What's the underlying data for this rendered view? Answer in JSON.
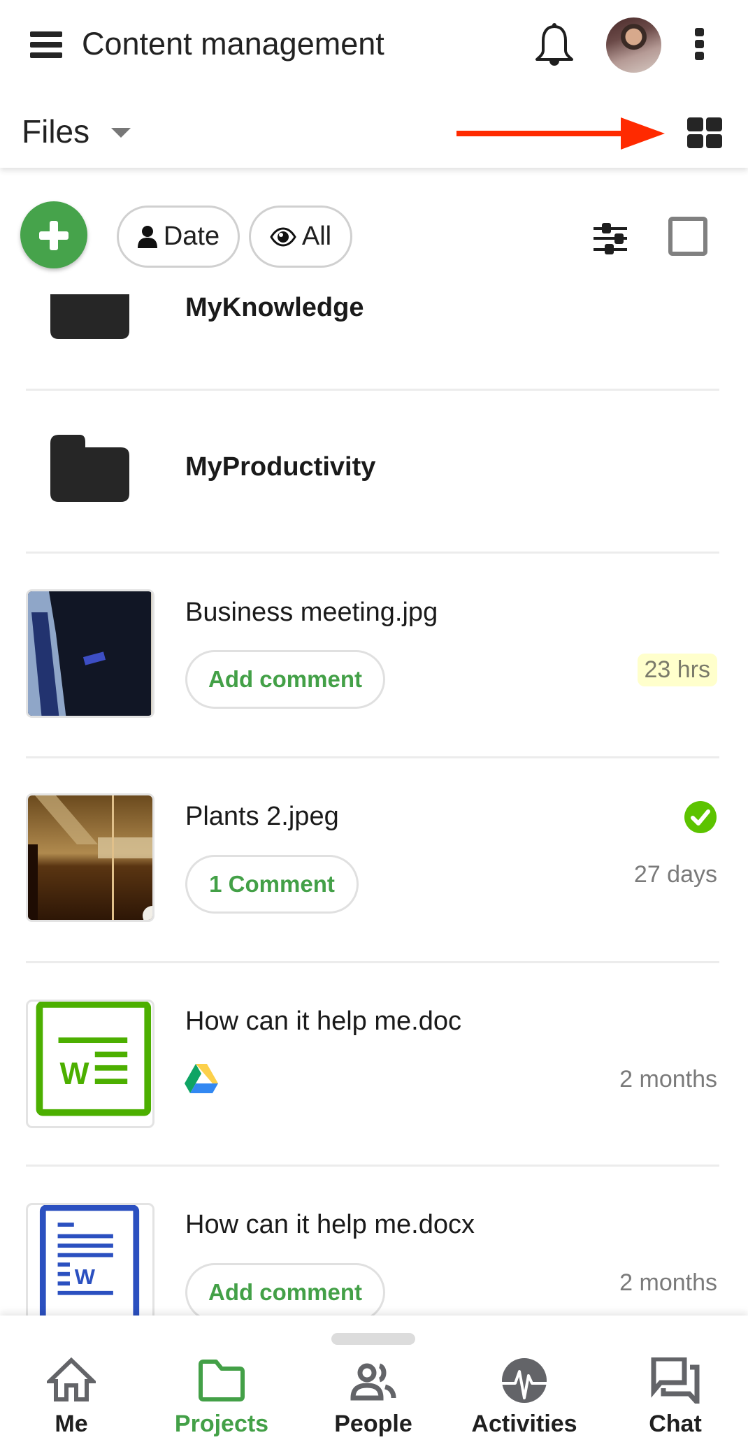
{
  "header": {
    "title": "Content management",
    "menu_icon": "hamburger-icon",
    "notification_icon": "bell-icon",
    "avatar_alt": "user-avatar",
    "overflow_icon": "kebab-menu-icon",
    "section_label": "Files",
    "view_toggle_icon": "grid-view-icon",
    "annotation": "red-arrow-pointing-to-grid-view"
  },
  "toolbar": {
    "add_icon": "plus-icon",
    "sort_label": "Date",
    "sort_icon": "person-icon",
    "filter_label": "All",
    "filter_icon": "eye-icon",
    "settings_icon": "sliders-icon",
    "select_icon": "checkbox-icon"
  },
  "colors": {
    "accent_green": "#43a047",
    "fab_green": "#46a34b",
    "doc_green": "#4caf00",
    "doc_blue": "#2b50c0",
    "badge_yellow": "#ffffcc",
    "annotation_red": "#ff2a00"
  },
  "folders": [
    {
      "name": "MyKnowledge"
    },
    {
      "name": "MyProductivity"
    }
  ],
  "files": [
    {
      "name": "Business meeting.jpg",
      "action": "Add comment",
      "age": "23 hrs",
      "age_highlight": true,
      "thumb": "photo-suit"
    },
    {
      "name": "Plants 2.jpeg",
      "action": "1 Comment",
      "age": "27 days",
      "status": "checked",
      "thumb": "photo-room"
    },
    {
      "name": "How can it help me.doc",
      "source": "google-drive",
      "age": "2 months",
      "thumb": "doc-green"
    },
    {
      "name": "How can it help me.docx",
      "action": "Add comment",
      "age": "2 months",
      "thumb": "doc-blue"
    }
  ],
  "bottom_nav": [
    {
      "label": "Me",
      "icon": "home-icon",
      "active": false
    },
    {
      "label": "Projects",
      "icon": "folder-icon",
      "active": true
    },
    {
      "label": "People",
      "icon": "people-icon",
      "active": false
    },
    {
      "label": "Activities",
      "icon": "activity-icon",
      "active": false
    },
    {
      "label": "Chat",
      "icon": "chat-icon",
      "active": false
    }
  ]
}
